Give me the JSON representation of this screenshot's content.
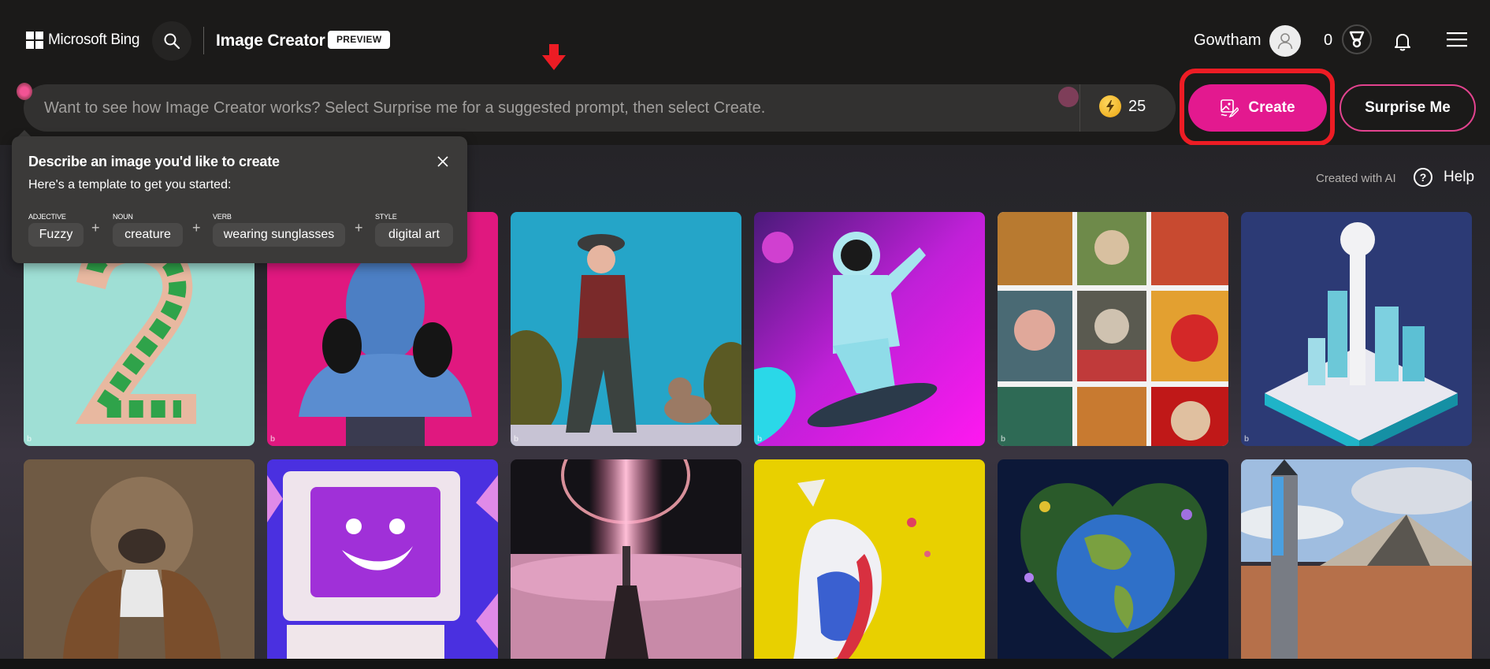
{
  "header": {
    "brand": "Microsoft Bing",
    "app_title": "Image Creator",
    "badge": "PREVIEW",
    "user_name": "Gowtham",
    "rewards_points": "0",
    "icons": {
      "search": "search-icon",
      "avatar": "user-icon",
      "rewards": "trophy-medal-icon",
      "notifications": "bell-icon",
      "menu": "hamburger-menu-icon"
    }
  },
  "annotation": {
    "arrow": "red-down-arrow",
    "highlight_color": "#ed1c24"
  },
  "prompt": {
    "placeholder": "Want to see how Image Creator works? Select Surprise me for a suggested prompt, then select Create.",
    "value": "",
    "boosts": "25",
    "boost_icon": "lightning-coin-icon"
  },
  "actions": {
    "create_label": "Create",
    "surprise_label": "Surprise Me",
    "accent_color": "#e3198f"
  },
  "popover": {
    "title": "Describe an image you'd like to create",
    "subtitle": "Here's a template to get you started:",
    "parts": [
      {
        "label": "ADJECTIVE",
        "value": "Fuzzy"
      },
      {
        "label": "NOUN",
        "value": "creature"
      },
      {
        "label": "VERB",
        "value": "wearing sunglasses"
      },
      {
        "label": "STYLE",
        "value": "digital art"
      }
    ],
    "plus": "+"
  },
  "gallery": {
    "created_with_ai": "Created with AI",
    "help_label": "Help",
    "watermark": "b",
    "images": [
      {
        "subject": "number 2 made of leaves"
      },
      {
        "subject": "statue bust with headphones"
      },
      {
        "subject": "old man walking dog"
      },
      {
        "subject": "astronaut on skateboard"
      },
      {
        "subject": "grid of folk-art portraits"
      },
      {
        "subject": "isometric futuristic city"
      },
      {
        "subject": "pug in victorian suit"
      },
      {
        "subject": "smiling retro computer"
      },
      {
        "subject": "figure under light beam above clouds"
      },
      {
        "subject": "exploding sneaker"
      },
      {
        "subject": "earth surrounded by flowers"
      },
      {
        "subject": "mirrored obelisk in desert"
      }
    ]
  }
}
